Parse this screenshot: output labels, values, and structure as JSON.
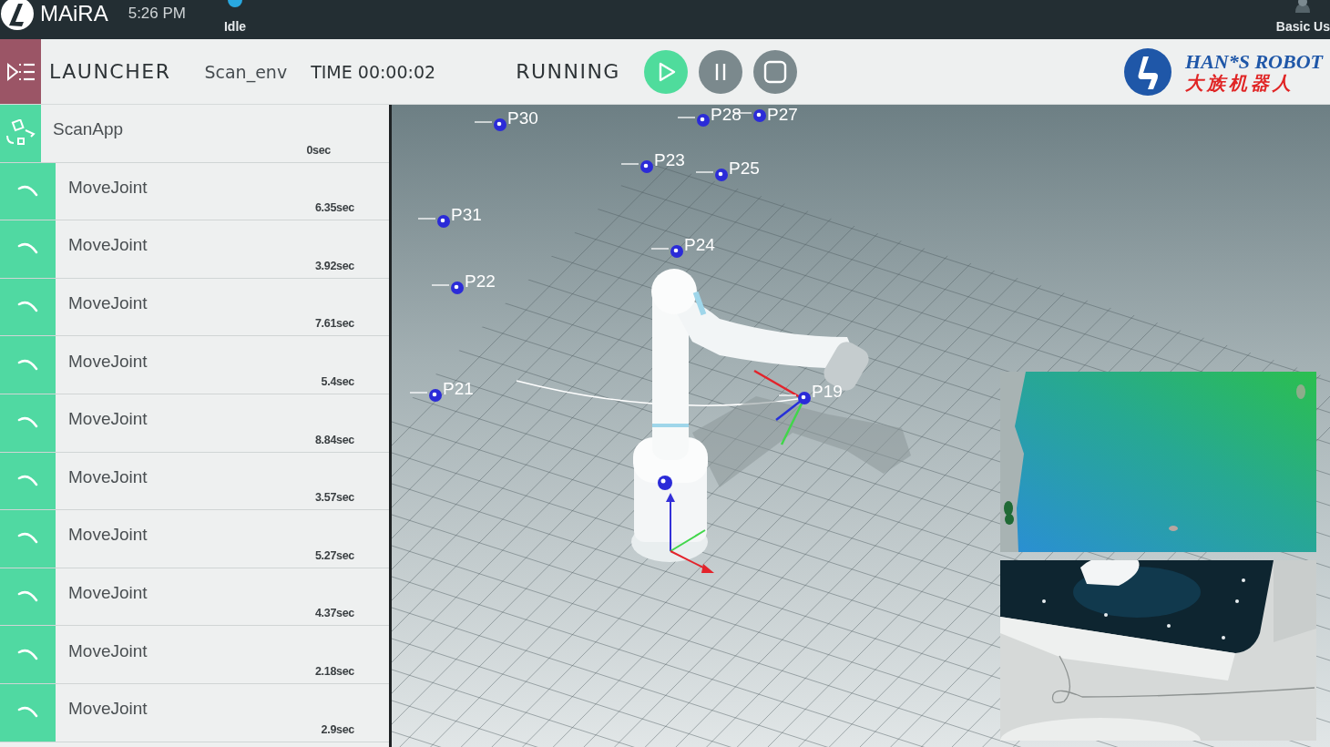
{
  "top_bar": {
    "brand": "MAiRA",
    "clock": "5:26 PM",
    "status": "Idle",
    "user": "Basic Us"
  },
  "toolbar": {
    "title": "LAUNCHER",
    "program": "Scan_env",
    "time": "TIME 00:00:02",
    "state": "RUNNING",
    "controls": [
      {
        "kind": "play",
        "active": true
      },
      {
        "kind": "pause",
        "active": false
      },
      {
        "kind": "stop",
        "active": false
      }
    ],
    "logo": {
      "name": "HAN*S ROBOT",
      "subtitle": "大族机器人"
    }
  },
  "app": {
    "name": "ScanApp",
    "duration": "0sec"
  },
  "steps": [
    {
      "name": "MoveJoint",
      "duration": "6.35sec"
    },
    {
      "name": "MoveJoint",
      "duration": "3.92sec"
    },
    {
      "name": "MoveJoint",
      "duration": "7.61sec"
    },
    {
      "name": "MoveJoint",
      "duration": "5.4sec"
    },
    {
      "name": "MoveJoint",
      "duration": "8.84sec"
    },
    {
      "name": "MoveJoint",
      "duration": "3.57sec"
    },
    {
      "name": "MoveJoint",
      "duration": "5.27sec"
    },
    {
      "name": "MoveJoint",
      "duration": "4.37sec"
    },
    {
      "name": "MoveJoint",
      "duration": "2.18sec"
    },
    {
      "name": "MoveJoint",
      "duration": "2.9sec"
    }
  ],
  "viewport": {
    "waypoints": [
      {
        "label": "P30"
      },
      {
        "label": "P28"
      },
      {
        "label": "P27"
      },
      {
        "label": "P23"
      },
      {
        "label": "P25"
      },
      {
        "label": "P31"
      },
      {
        "label": "P24"
      },
      {
        "label": "P22"
      },
      {
        "label": "P21"
      },
      {
        "label": "P19"
      }
    ]
  }
}
